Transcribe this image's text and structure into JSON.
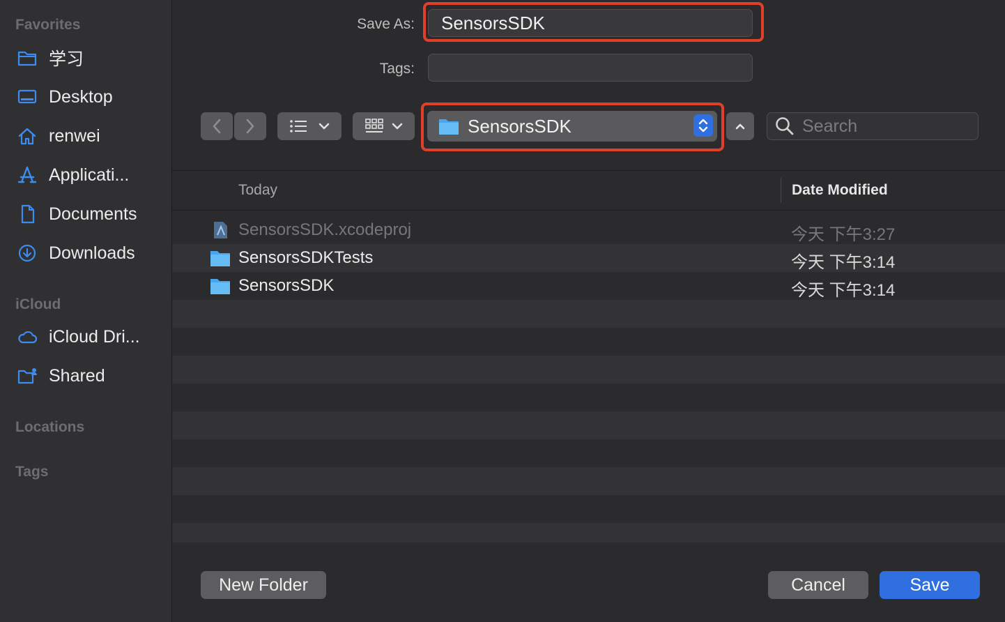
{
  "sidebar": {
    "favorites_label": "Favorites",
    "favorites": [
      {
        "label": "学习",
        "icon": "folder-icon"
      },
      {
        "label": "Desktop",
        "icon": "desktop-icon"
      },
      {
        "label": "renwei",
        "icon": "home-icon"
      },
      {
        "label": "Applicati...",
        "icon": "applications-icon"
      },
      {
        "label": "Documents",
        "icon": "document-icon"
      },
      {
        "label": "Downloads",
        "icon": "download-icon"
      }
    ],
    "icloud_label": "iCloud",
    "icloud": [
      {
        "label": "iCloud Dri...",
        "icon": "cloud-icon"
      },
      {
        "label": "Shared",
        "icon": "shared-folder-icon"
      }
    ],
    "locations_label": "Locations",
    "tags_label": "Tags"
  },
  "form": {
    "save_as_label": "Save As:",
    "save_as_value": "SensorsSDK",
    "tags_label": "Tags:",
    "tags_value": ""
  },
  "toolbar": {
    "location_popup": "SensorsSDK",
    "search_placeholder": "Search"
  },
  "list": {
    "group_header": "Today",
    "date_header": "Date Modified",
    "rows": [
      {
        "name": "SensorsSDK.xcodeproj",
        "date": "今天 下午3:27",
        "icon": "xcodeproj-file-icon",
        "dimmed": true
      },
      {
        "name": "SensorsSDKTests",
        "date": "今天 下午3:14",
        "icon": "folder-icon",
        "dimmed": false
      },
      {
        "name": "SensorsSDK",
        "date": "今天 下午3:14",
        "icon": "folder-icon",
        "dimmed": false
      }
    ]
  },
  "buttons": {
    "new_folder": "New Folder",
    "cancel": "Cancel",
    "save": "Save"
  },
  "colors": {
    "accent": "#2f6fe0",
    "highlight_box": "#e0402a",
    "folder": "#5db3f0"
  }
}
